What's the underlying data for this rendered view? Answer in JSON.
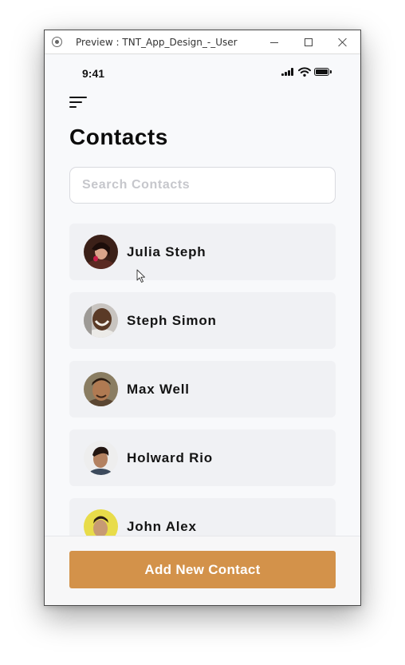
{
  "window": {
    "title": "Preview : TNT_App_Design_-_User"
  },
  "status_bar": {
    "time": "9:41",
    "icons": [
      "signal-icon",
      "wifi-icon",
      "battery-icon"
    ]
  },
  "header": {
    "menu_icon": "menu-icon",
    "title": "Contacts"
  },
  "search": {
    "placeholder": "Search Contacts",
    "value": ""
  },
  "contacts": [
    {
      "name": "Julia Steph"
    },
    {
      "name": "Steph Simon"
    },
    {
      "name": "Max Well"
    },
    {
      "name": "Holward Rio"
    },
    {
      "name": "John Alex"
    }
  ],
  "footer": {
    "add_button_label": "Add New Contact"
  },
  "colors": {
    "accent": "#d3924a",
    "background": "#f8f9fb",
    "card": "#f0f1f4",
    "text": "#141414",
    "placeholder": "#c6c7cc"
  }
}
